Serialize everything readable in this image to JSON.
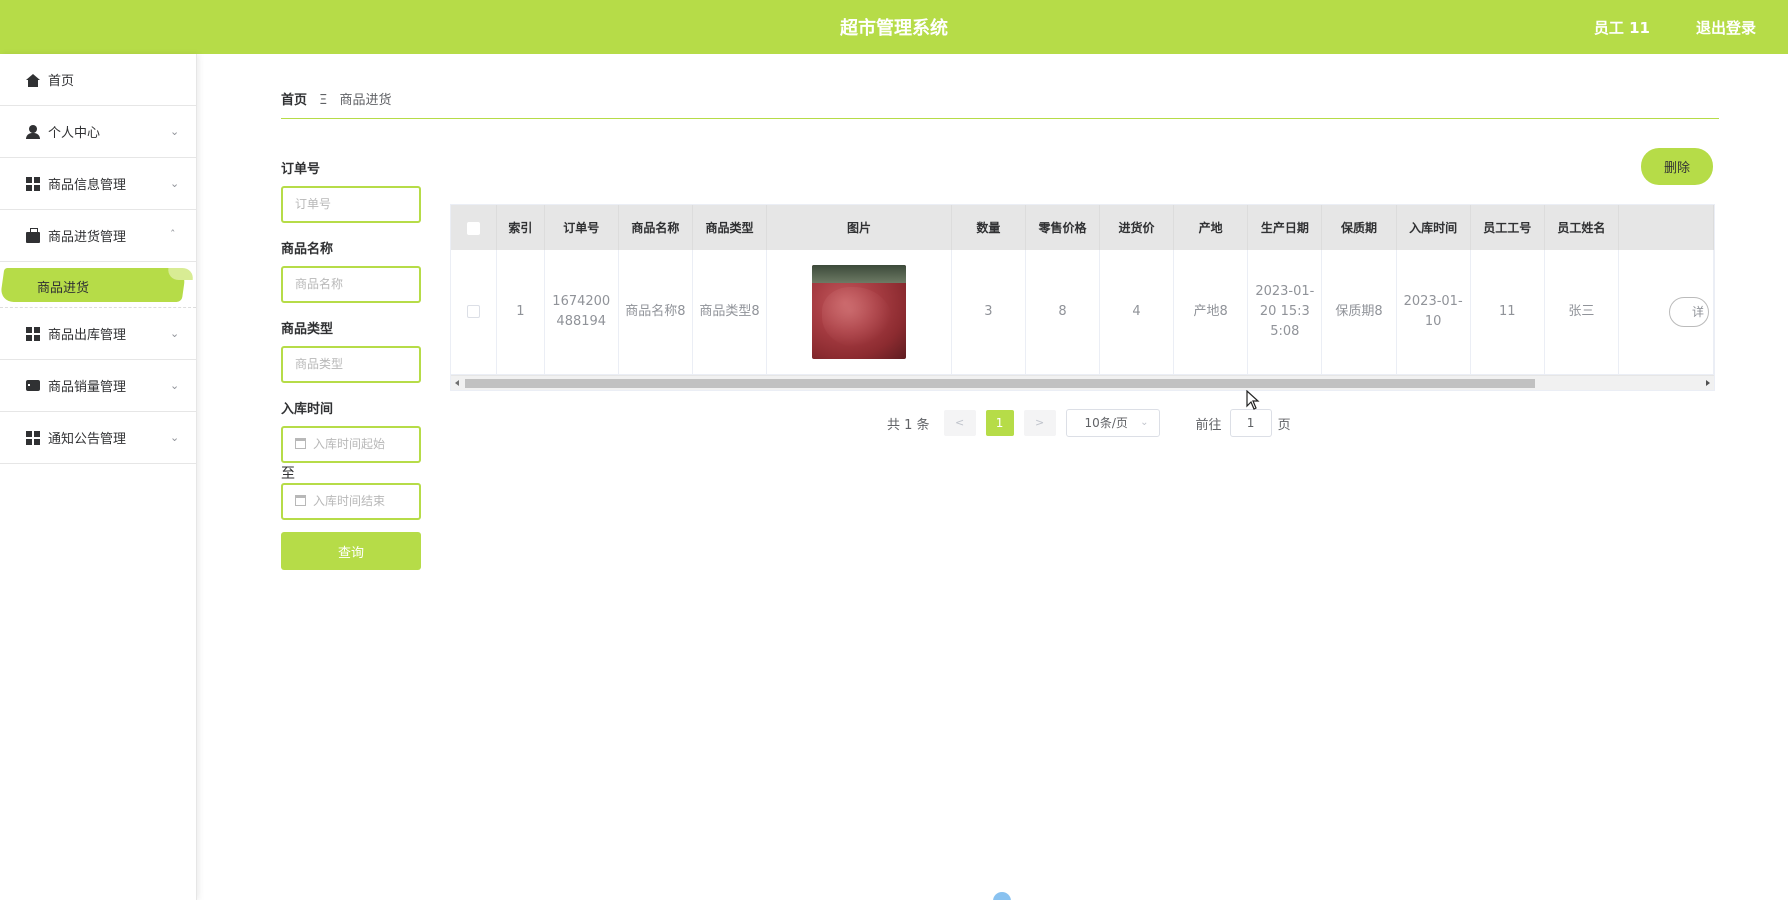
{
  "header": {
    "title": "超市管理系统",
    "user": "员工 11",
    "logout": "退出登录"
  },
  "sidebar": {
    "items": [
      {
        "label": "首页",
        "icon": "home-icon"
      },
      {
        "label": "个人中心",
        "icon": "user-icon"
      },
      {
        "label": "商品信息管理",
        "icon": "grid-icon"
      },
      {
        "label": "商品进货管理",
        "icon": "briefcase-icon",
        "expanded": true,
        "children": [
          {
            "label": "商品进货",
            "active": true
          }
        ]
      },
      {
        "label": "商品出库管理",
        "icon": "grid-icon"
      },
      {
        "label": "商品销量管理",
        "icon": "chat-icon"
      },
      {
        "label": "通知公告管理",
        "icon": "grid-icon"
      }
    ]
  },
  "breadcrumb": {
    "home": "首页",
    "separator": "Ξ",
    "current": "商品进货"
  },
  "filters": {
    "order_no": {
      "label": "订单号",
      "placeholder": "订单号"
    },
    "product_name": {
      "label": "商品名称",
      "placeholder": "商品名称"
    },
    "product_type": {
      "label": "商品类型",
      "placeholder": "商品类型"
    },
    "stock_time": {
      "label": "入库时间",
      "start_placeholder": "入库时间起始",
      "to": "至",
      "end_placeholder": "入库时间结束"
    },
    "query_button": "查询"
  },
  "actions": {
    "delete_button": "删除"
  },
  "table": {
    "columns": [
      "索引",
      "订单号",
      "商品名称",
      "商品类型",
      "图片",
      "数量",
      "零售价格",
      "进货价",
      "产地",
      "生产日期",
      "保质期",
      "入库时间",
      "员工工号",
      "员工姓名"
    ],
    "rows": [
      {
        "index": "1",
        "order_no": "1674200488194",
        "product_name": "商品名称8",
        "product_type": "商品类型8",
        "image": "raw-beef-photo",
        "quantity": "3",
        "retail_price": "8",
        "purchase_price": "4",
        "origin": "产地8",
        "production_date": "2023-01-20 15:35:08",
        "shelf_life": "保质期8",
        "stock_time": "2023-01-10",
        "employee_no": "11",
        "employee_name": "张三",
        "detail_button": "详"
      }
    ]
  },
  "pagination": {
    "total": "共 1 条",
    "prev": "<",
    "current_page": "1",
    "next": ">",
    "page_size": "10条/页",
    "goto_label": "前往",
    "goto_value": "1",
    "page_unit": "页"
  },
  "colors": {
    "accent": "#b6dc48",
    "header_bg": "#b6dc48",
    "table_header_bg": "#e6e6e6"
  }
}
